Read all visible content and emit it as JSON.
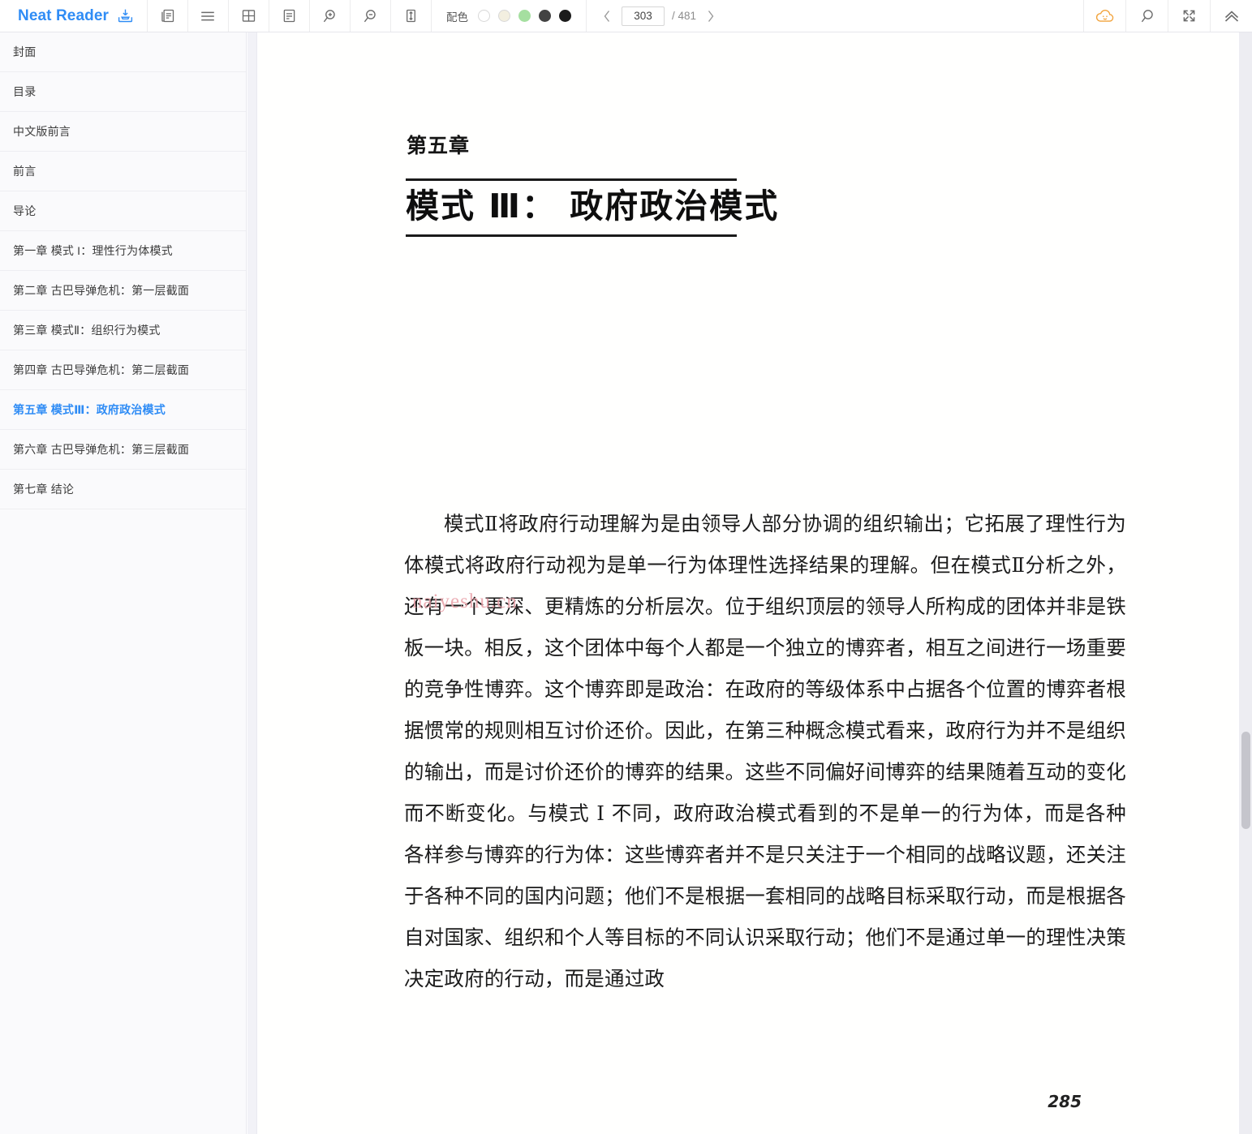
{
  "app": {
    "brand": "Neat Reader",
    "brand_color": "#2f8cf5",
    "brand_icon": "save-to-library-icon"
  },
  "toolbar": {
    "buttons": [
      {
        "name": "two-page-view-icon",
        "title": "双页"
      },
      {
        "name": "toc-menu-icon",
        "title": "目录"
      },
      {
        "name": "grid-view-icon",
        "title": "网格"
      },
      {
        "name": "notes-icon",
        "title": "笔记"
      },
      {
        "name": "zoom-in-icon",
        "title": "放大"
      },
      {
        "name": "zoom-out-icon",
        "title": "缩小"
      },
      {
        "name": "fit-height-icon",
        "title": "适合高度"
      }
    ],
    "color_scheme": {
      "label": "配色",
      "swatches": [
        {
          "name": "scheme-white",
          "color": "#ffffff"
        },
        {
          "name": "scheme-cream",
          "color": "#f3efe0"
        },
        {
          "name": "scheme-green",
          "color": "#a5dfa0"
        },
        {
          "name": "scheme-gray",
          "color": "#434343"
        },
        {
          "name": "scheme-black",
          "color": "#1c1c1c"
        }
      ]
    },
    "pager": {
      "prev_label": "‹",
      "next_label": "›",
      "current_page": "303",
      "total_label": "/ 481",
      "placeholder": "303"
    },
    "right_buttons": [
      {
        "name": "cloud-sync-icon",
        "title": "云同步",
        "color": "#f2a33c"
      },
      {
        "name": "search-icon",
        "title": "搜索"
      },
      {
        "name": "fullscreen-icon",
        "title": "全屏"
      },
      {
        "name": "collapse-toolbar-icon",
        "title": "收起"
      }
    ]
  },
  "sidebar": {
    "items": [
      {
        "label": "封面",
        "active": false
      },
      {
        "label": "目录",
        "active": false
      },
      {
        "label": "中文版前言",
        "active": false
      },
      {
        "label": "前言",
        "active": false
      },
      {
        "label": "导论",
        "active": false
      },
      {
        "label": "第一章 模式 I：理性行为体模式",
        "active": false
      },
      {
        "label": "第二章 古巴导弹危机：第一层截面",
        "active": false
      },
      {
        "label": "第三章 模式Ⅱ：组织行为模式",
        "active": false
      },
      {
        "label": "第四章 古巴导弹危机：第二层截面",
        "active": false
      },
      {
        "label": "第五章 模式Ⅲ：政府政治模式",
        "active": true
      },
      {
        "label": "第六章 古巴导弹危机：第三层截面",
        "active": false
      },
      {
        "label": "第七章 结论",
        "active": false
      }
    ],
    "active_color": "#2f8cf5"
  },
  "page": {
    "chapter_label": "第五章",
    "chapter_title": "模式 Ⅲ： 政府政治模式",
    "body": "模式Ⅱ将政府行动理解为是由领导人部分协调的组织输出；它拓展了理性行为体模式将政府行动视为是单一行为体理性选择结果的理解。但在模式Ⅱ分析之外，还有一个更深、更精炼的分析层次。位于组织顶层的领导人所构成的团体并非是铁板一块。相反，这个团体中每个人都是一个独立的博弈者，相互之间进行一场重要的竞争性博弈。这个博弈即是政治：在政府的等级体系中占据各个位置的博弈者根据惯常的规则相互讨价还价。因此，在第三种概念模式看来，政府行为并不是组织的输出，而是讨价还价的博弈的结果。这些不同偏好间博弈的结果随着互动的变化而不断变化。与模式 I 不同，政府政治模式看到的不是单一的行为体，而是各种各样参与博弈的行为体：这些博弈者并不是只关注于一个相同的战略议题，还关注于各种不同的国内问题；他们不是根据一套相同的战略目标采取行动，而是根据各自对国家、组织和个人等目标的不同认识采取行动；他们不是通过单一的理性决策决定政府的行动，而是通过政",
    "watermark": "naiyeshu.cn",
    "page_number": "285"
  }
}
